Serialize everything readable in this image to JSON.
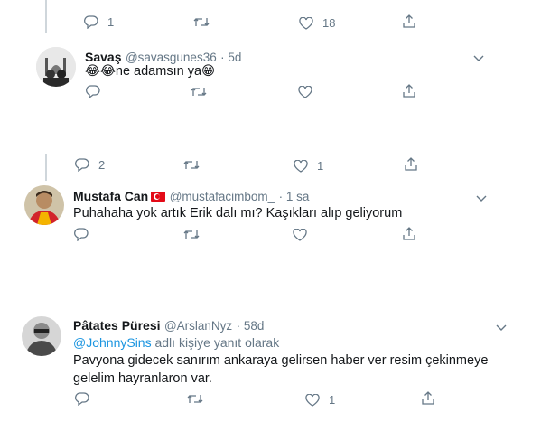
{
  "top_actions": {
    "reply_count": "1",
    "like_count": "18"
  },
  "tweet1": {
    "name": "Savaş",
    "handle": "@savasgunes36",
    "time": "· 5d",
    "emoji_prefix": "😂😂",
    "text": "ne adamsın ya",
    "emoji_suffix": "😁"
  },
  "tweet1_replies_row": {
    "reply_count": "2",
    "like_count": "1"
  },
  "tweet2": {
    "name": "Mustafa Can",
    "handle": "@mustafacimbom_",
    "time": "· 1 sa",
    "text": "Puhahaha yok artık Erik dalı mı? Kaşıkları alıp geliyorum"
  },
  "tweet3": {
    "name": "Pâtates Püresi",
    "handle": "@ArslanNyz",
    "time": "· 58d",
    "reply_to_user": "@JohnnySins",
    "reply_to_suffix": " adlı kişiye yanıt olarak",
    "text_line1": "Pavyona gidecek sanırım ankaraya gelirsen haber ver resim çekinmeye",
    "text_line2": "gelelim hayranlaron var.",
    "like_count": "1"
  },
  "colors": {
    "text_primary": "#14171a",
    "text_secondary": "#657786",
    "link": "#1b95e0",
    "thread_line": "#cfd6db",
    "separator": "#e6ecf0"
  },
  "icons": [
    "reply-icon",
    "retweet-icon",
    "like-icon",
    "share-icon",
    "chevron-down-icon",
    "turkey-flag-icon"
  ]
}
